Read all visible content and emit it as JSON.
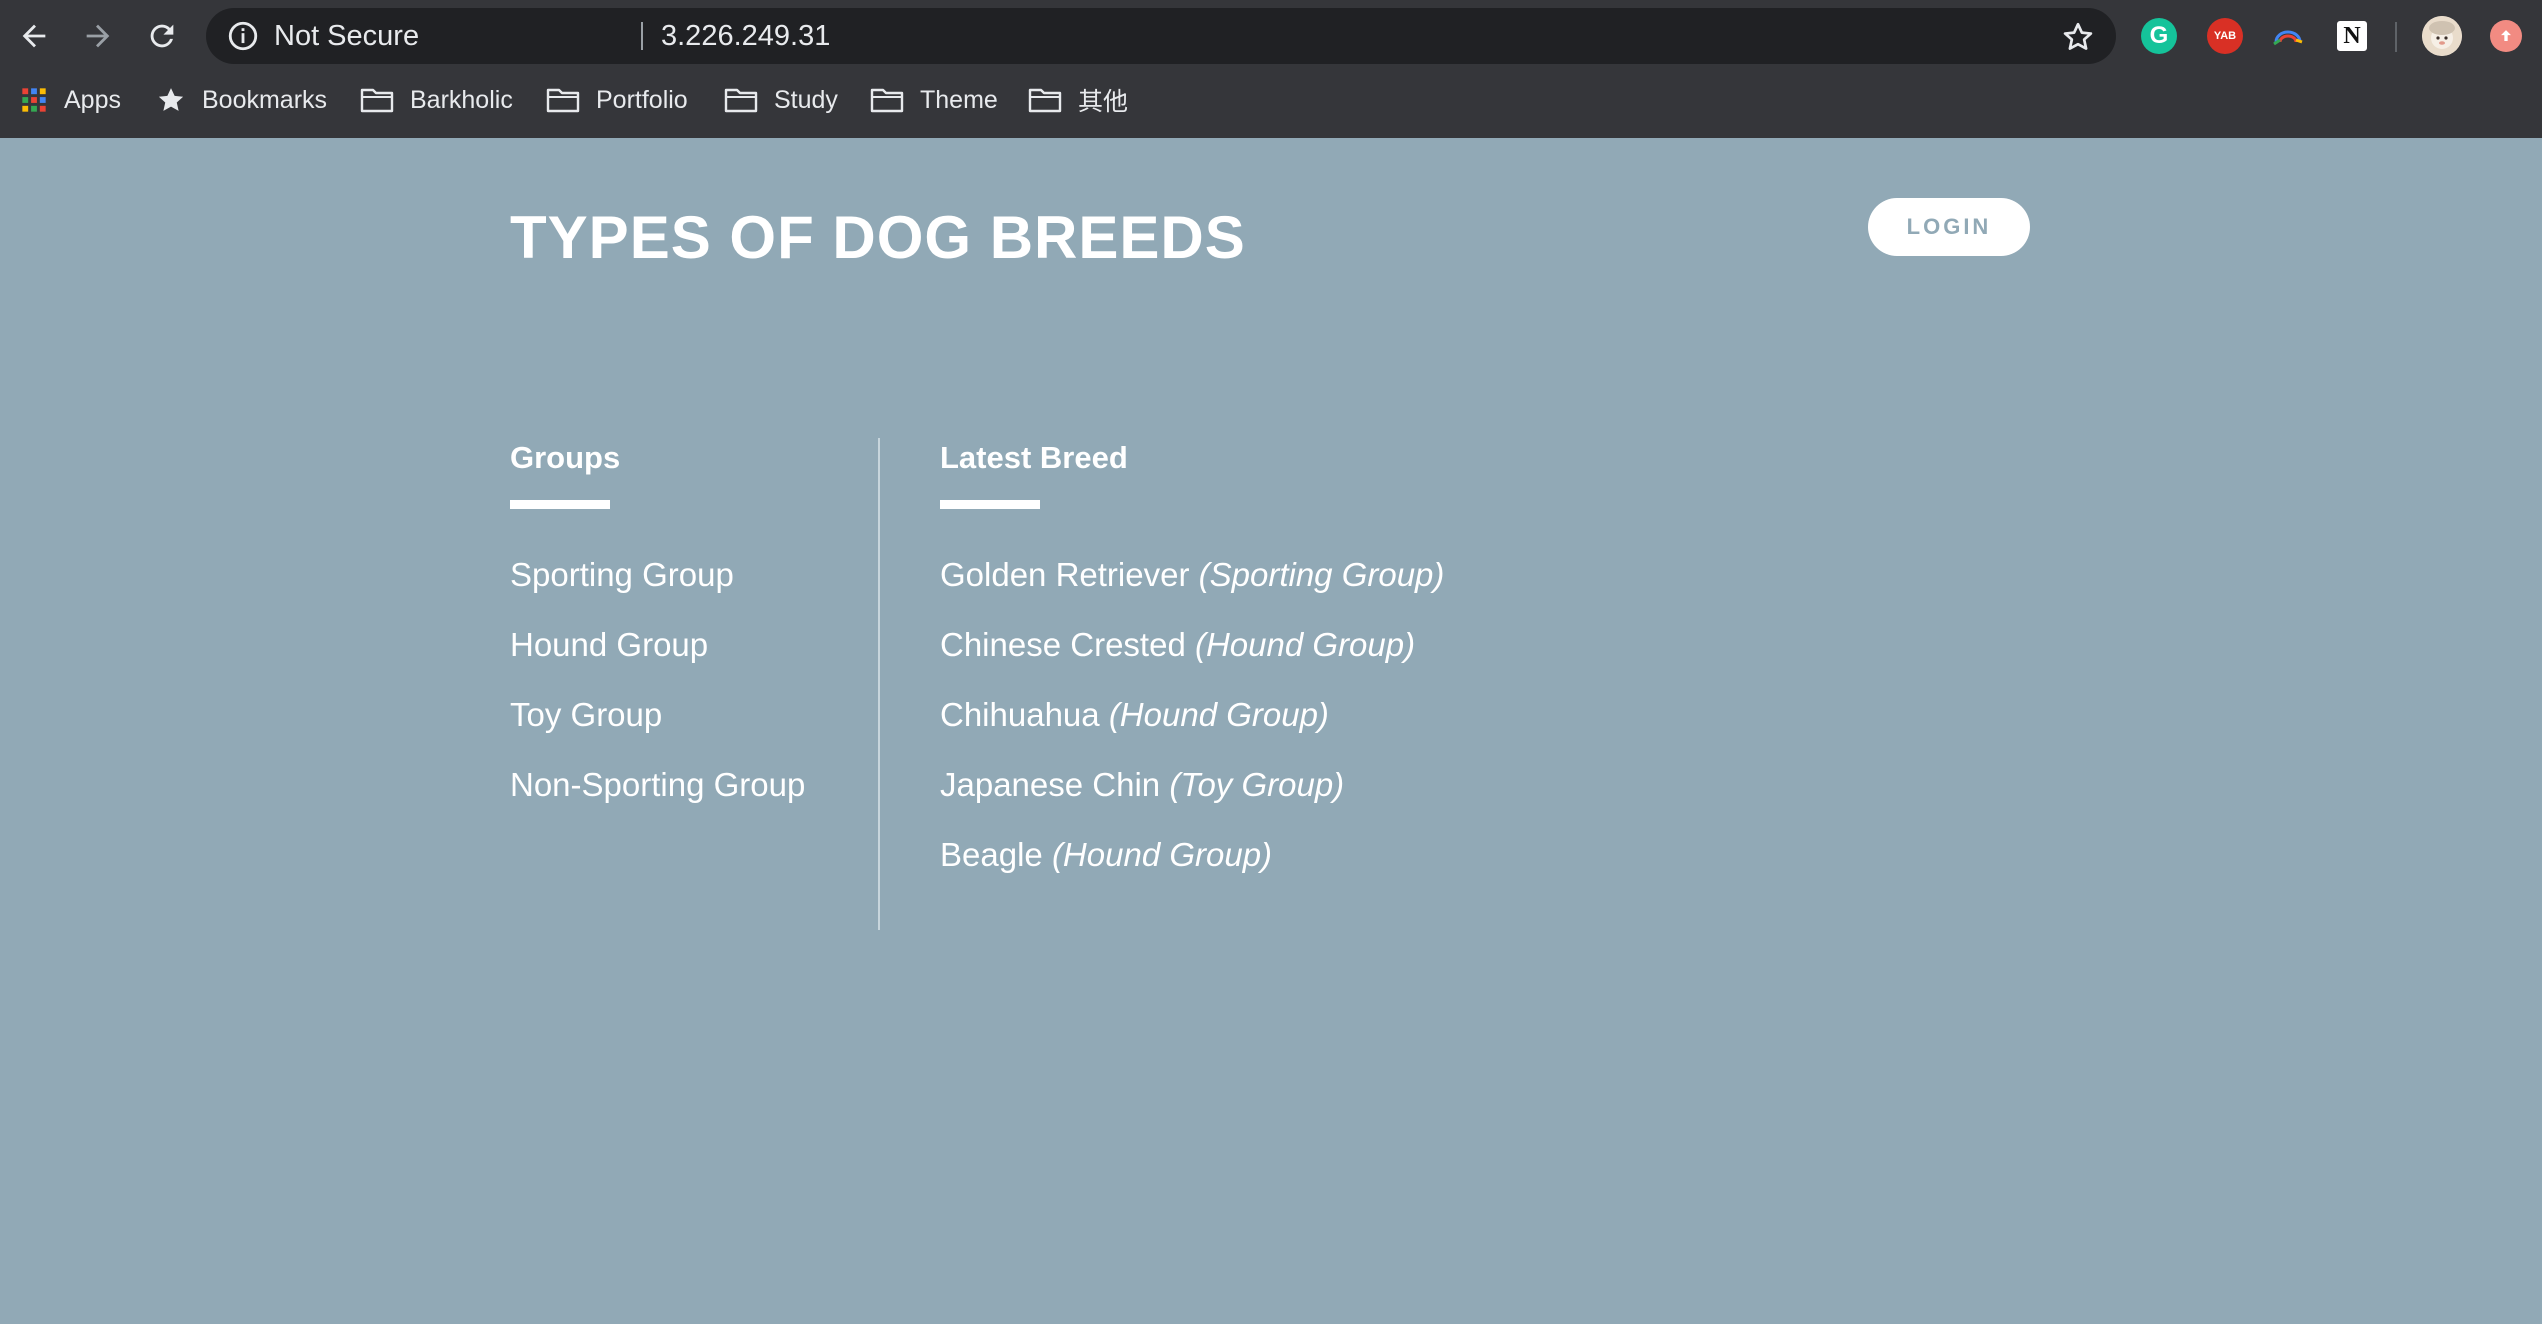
{
  "browser": {
    "security_label": "Not Secure",
    "url": "3.226.249.31",
    "extensions": {
      "grammarly_letter": "G",
      "yab_label": "YAB",
      "notion_letter": "N"
    },
    "bookmarks": [
      {
        "label": "Apps",
        "icon": "apps-grid-icon"
      },
      {
        "label": "Bookmarks",
        "icon": "star-icon"
      },
      {
        "label": "Barkholic",
        "icon": "folder-icon"
      },
      {
        "label": "Portfolio",
        "icon": "folder-icon"
      },
      {
        "label": "Study",
        "icon": "folder-icon"
      },
      {
        "label": "Theme",
        "icon": "folder-icon"
      },
      {
        "label": "其他",
        "icon": "folder-icon"
      }
    ]
  },
  "page": {
    "title": "TYPES OF DOG BREEDS",
    "login_label": "LOGIN",
    "background_color": "#91a9b6",
    "groups": {
      "heading": "Groups",
      "items": [
        "Sporting Group",
        "Hound Group",
        "Toy Group",
        "Non-Sporting Group"
      ]
    },
    "latest": {
      "heading": "Latest Breed",
      "items": [
        {
          "breed": "Golden Retriever",
          "group": "(Sporting Group)"
        },
        {
          "breed": "Chinese Crested",
          "group": "(Hound Group)"
        },
        {
          "breed": "Chihuahua",
          "group": "(Hound Group)"
        },
        {
          "breed": "Japanese Chin",
          "group": "(Toy Group)"
        },
        {
          "breed": "Beagle",
          "group": "(Hound Group)"
        }
      ]
    }
  }
}
